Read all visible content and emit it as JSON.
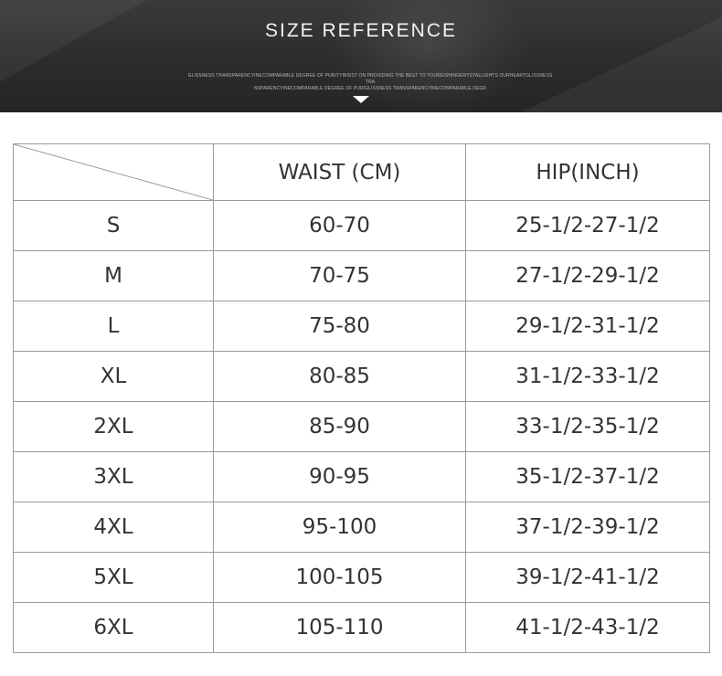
{
  "banner": {
    "title": "SIZE REFERENCE",
    "fine_print_line1": "GLISSNESS TRANSPARENCYINECOMPARABLE DEGREE OF PURITYINSIST ON PROVIDING THE BEST TO YOUREISHINGERYSTALLIGHTS OURHEARTGLISSNESS TRA",
    "fine_print_line2": "NSPARENCYINECOMPARABLE DEGREE OF PURIGLISSNESS TRANSPARENCYINECOMPARABLE DEGR",
    "arrow_icon": "triangle-down-icon"
  },
  "table": {
    "headers": [
      "",
      "WAIST (CM)",
      "HIP(INCH)"
    ],
    "rows": [
      {
        "size": "S",
        "waist": "60-70",
        "hip": "25-1/2-27-1/2"
      },
      {
        "size": "M",
        "waist": "70-75",
        "hip": "27-1/2-29-1/2"
      },
      {
        "size": "L",
        "waist": "75-80",
        "hip": "29-1/2-31-1/2"
      },
      {
        "size": "XL",
        "waist": "80-85",
        "hip": "31-1/2-33-1/2"
      },
      {
        "size": "2XL",
        "waist": "85-90",
        "hip": "33-1/2-35-1/2"
      },
      {
        "size": "3XL",
        "waist": "90-95",
        "hip": "35-1/2-37-1/2"
      },
      {
        "size": "4XL",
        "waist": "95-100",
        "hip": "37-1/2-39-1/2"
      },
      {
        "size": "5XL",
        "waist": "100-105",
        "hip": "39-1/2-41-1/2"
      },
      {
        "size": "6XL",
        "waist": "105-110",
        "hip": "41-1/2-43-1/2"
      }
    ]
  },
  "colors": {
    "banner_background": "#2c2c2c",
    "banner_text": "#f2f2f2",
    "table_border": "#9a9a9a",
    "table_text": "#333333"
  }
}
